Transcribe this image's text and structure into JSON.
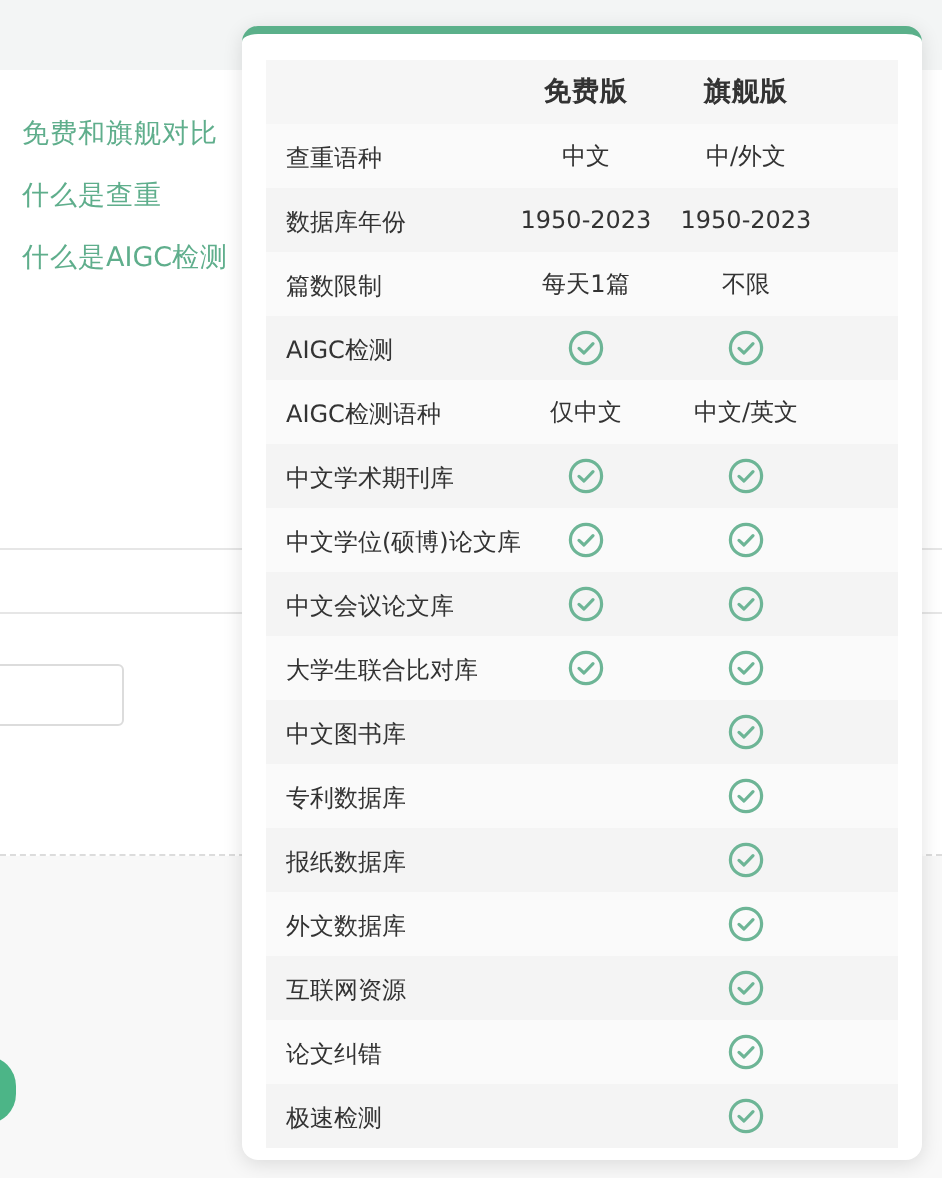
{
  "side_links": [
    {
      "label": "免费和旗舰对比"
    },
    {
      "label": "什么是查重"
    },
    {
      "label": "什么是AIGC检测"
    }
  ],
  "comparison": {
    "columns": [
      "免费版",
      "旗舰版"
    ],
    "rows": [
      {
        "label": "查重语种",
        "free": {
          "kind": "text",
          "text": "中文"
        },
        "flagship": {
          "kind": "text",
          "text": "中/外文"
        }
      },
      {
        "label": "数据库年份",
        "free": {
          "kind": "text",
          "text": "1950-2023"
        },
        "flagship": {
          "kind": "text",
          "text": "1950-2023"
        }
      },
      {
        "label": "篇数限制",
        "free": {
          "kind": "text",
          "text": "每天1篇"
        },
        "flagship": {
          "kind": "text",
          "text": "不限"
        }
      },
      {
        "label": "AIGC检测",
        "free": {
          "kind": "check"
        },
        "flagship": {
          "kind": "check"
        }
      },
      {
        "label": "AIGC检测语种",
        "free": {
          "kind": "text",
          "text": "仅中文"
        },
        "flagship": {
          "kind": "text",
          "text": "中文/英文"
        }
      },
      {
        "label": "中文学术期刊库",
        "free": {
          "kind": "check"
        },
        "flagship": {
          "kind": "check"
        }
      },
      {
        "label": "中文学位(硕博)论文库",
        "free": {
          "kind": "check"
        },
        "flagship": {
          "kind": "check"
        }
      },
      {
        "label": "中文会议论文库",
        "free": {
          "kind": "check"
        },
        "flagship": {
          "kind": "check"
        }
      },
      {
        "label": "大学生联合比对库",
        "free": {
          "kind": "check"
        },
        "flagship": {
          "kind": "check"
        }
      },
      {
        "label": "中文图书库",
        "flagship": {
          "kind": "check"
        }
      },
      {
        "label": "专利数据库",
        "flagship": {
          "kind": "check"
        }
      },
      {
        "label": "报纸数据库",
        "flagship": {
          "kind": "check"
        }
      },
      {
        "label": "外文数据库",
        "flagship": {
          "kind": "check"
        }
      },
      {
        "label": "互联网资源",
        "flagship": {
          "kind": "check"
        }
      },
      {
        "label": "论文纠错",
        "flagship": {
          "kind": "check"
        }
      },
      {
        "label": "极速检测",
        "flagship": {
          "kind": "check"
        }
      }
    ]
  }
}
